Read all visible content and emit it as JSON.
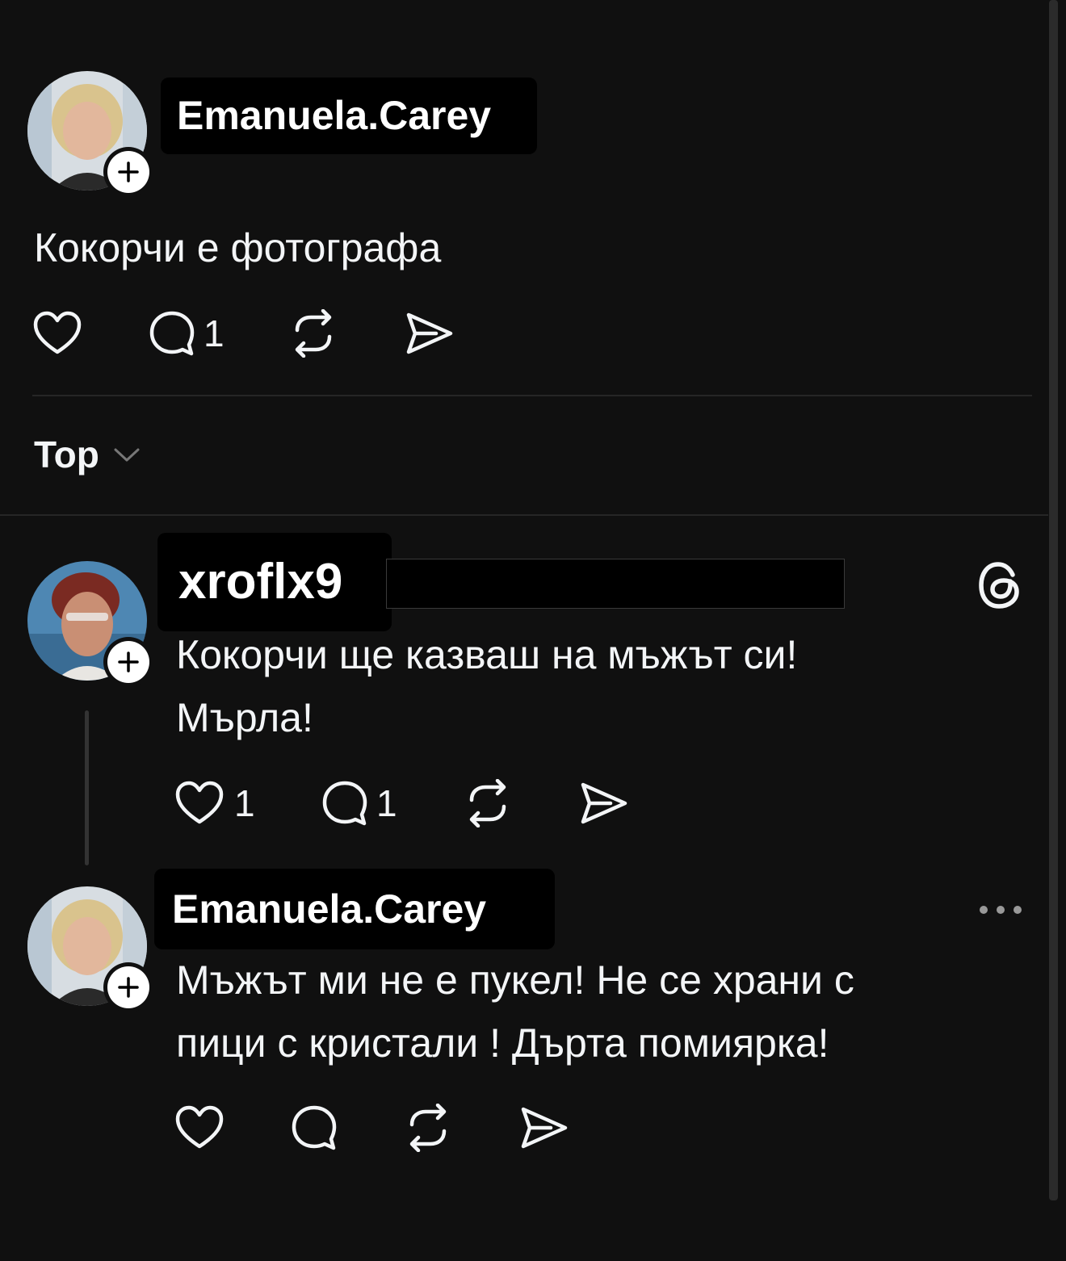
{
  "post": {
    "username": "Emanuela.Carey",
    "text": "Кокорчи е фотографа",
    "reply_count": "1"
  },
  "sort": {
    "label": "Top"
  },
  "replies": [
    {
      "username": "xroflx9",
      "text_line1": "Кокорчи ще казваш на мъжът си!",
      "text_line2": "Мърла!",
      "like_count": "1",
      "reply_count": "1"
    },
    {
      "username": "Emanuela.Carey",
      "text_line1": "Мъжът ми не е пукел! Не се храни с",
      "text_line2": "пици с кристали ! Дърта помиярка!"
    }
  ],
  "icons": {
    "like": "heart-icon",
    "reply": "comment-icon",
    "repost": "repost-icon",
    "share": "share-icon",
    "follow": "plus-icon",
    "brand": "threads-logo-icon",
    "more": "more-icon"
  },
  "colors": {
    "background": "#101010",
    "text": "#f3f5f7",
    "divider": "#262626"
  }
}
